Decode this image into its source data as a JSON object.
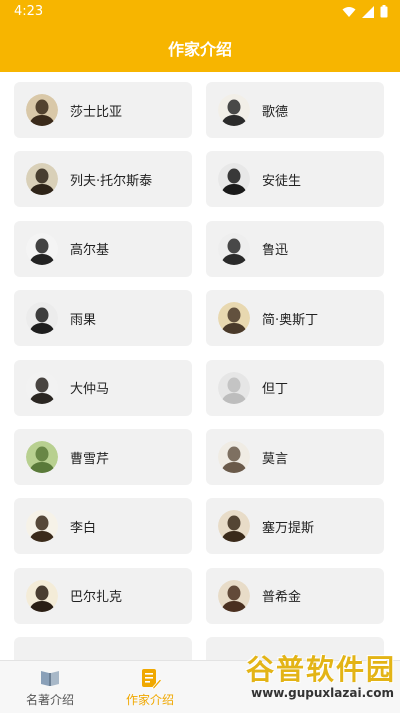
{
  "status_bar": {
    "time": "4:23"
  },
  "app_bar": {
    "title": "作家介绍"
  },
  "authors": [
    {
      "name": "莎士比亚",
      "icon": "shakespeare-portrait"
    },
    {
      "name": "歌德",
      "icon": "goethe-portrait"
    },
    {
      "name": "列夫·托尔斯泰",
      "icon": "tolstoy-portrait"
    },
    {
      "name": "安徒生",
      "icon": "andersen-portrait"
    },
    {
      "name": "高尔基",
      "icon": "gorky-portrait"
    },
    {
      "name": "鲁迅",
      "icon": "lu-xun-portrait"
    },
    {
      "name": "雨果",
      "icon": "hugo-portrait"
    },
    {
      "name": "简·奥斯丁",
      "icon": "jane-austen-portrait"
    },
    {
      "name": "大仲马",
      "icon": "dumas-portrait"
    },
    {
      "name": "但丁",
      "icon": "dante-portrait"
    },
    {
      "name": "曹雪芹",
      "icon": "cao-xueqin-portrait"
    },
    {
      "name": "莫言",
      "icon": "mo-yan-portrait"
    },
    {
      "name": "李白",
      "icon": "li-bai-portrait"
    },
    {
      "name": "塞万提斯",
      "icon": "cervantes-portrait"
    },
    {
      "name": "巴尔扎克",
      "icon": "balzac-portrait"
    },
    {
      "name": "普希金",
      "icon": "pushkin-portrait"
    }
  ],
  "bottom_nav": {
    "tabs": [
      {
        "label": "名著介绍",
        "icon": "book-icon",
        "active": false
      },
      {
        "label": "作家介绍",
        "icon": "note-edit-icon",
        "active": true
      }
    ]
  },
  "watermark": {
    "title": "谷普软件园",
    "url": "www.gupuxlazai.com"
  },
  "colors": {
    "accent": "#f7b500",
    "active_tab": "#f0a800",
    "inactive_tab": "#555555",
    "card_bg": "#f1f1f1"
  }
}
